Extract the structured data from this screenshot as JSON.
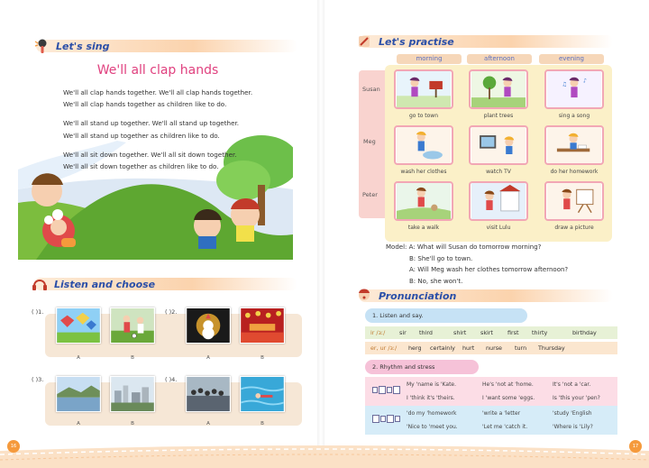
{
  "left_page": {
    "sing": {
      "section_title": "Let's sing",
      "song_title": "We'll all clap hands",
      "stanzas": [
        [
          "We'll all clap hands together.  We'll all clap hands together.",
          "We'll all clap hands together as children like to do."
        ],
        [
          "We'll all stand up together.  We'll all stand up together.",
          "We'll all stand up together as children like to do."
        ],
        [
          "We'll all sit down together.  We'll all sit down together.",
          "We'll all sit down together as children like to do."
        ]
      ]
    },
    "listen": {
      "section_title": "Listen and choose",
      "questions": [
        {
          "label": "(  )1.",
          "options": [
            "A",
            "B"
          ]
        },
        {
          "label": "(  )2.",
          "options": [
            "A",
            "B"
          ]
        },
        {
          "label": "(  )3.",
          "options": [
            "A",
            "B"
          ]
        },
        {
          "label": "(  )4.",
          "options": [
            "A",
            "B"
          ]
        }
      ]
    },
    "page_number": "16"
  },
  "right_page": {
    "practise": {
      "section_title": "Let's practise",
      "times": [
        "morning",
        "afternoon",
        "evening"
      ],
      "people": [
        "Susan",
        "Meg",
        "Peter"
      ],
      "activities": [
        [
          "go to town",
          "plant trees",
          "sing a song"
        ],
        [
          "wash her clothes",
          "watch TV",
          "do her homework"
        ],
        [
          "take a walk",
          "visit Lulu",
          "draw a picture"
        ]
      ],
      "model": [
        "Model:  A: What will Susan do tomorrow morning?",
        "B: She'll go to town.",
        "A: Will Meg wash her clothes tomorrow afternoon?",
        "B: No, she won't."
      ]
    },
    "pronunciation": {
      "section_title": "Pronunciation",
      "listen_say_label": "1. Listen and say.",
      "rows": [
        {
          "sound": "ir /ɜː/",
          "words": [
            "sir",
            "third",
            "shirt",
            "skirt",
            "first",
            "thirty",
            "birthday"
          ]
        },
        {
          "sound": "er, ur /ɜː/",
          "words": [
            "herg",
            "certainly",
            "hurt",
            "nurse",
            "turn",
            "Thursday"
          ]
        }
      ],
      "rhythm_label": "2. Rhythm and stress",
      "rhythm": [
        [
          [
            "My 'name is 'Kate.",
            "I 'think it's 'theirs."
          ],
          [
            "He's 'not at 'home.",
            "I 'want some 'eggs."
          ],
          [
            "It's 'not a 'car.",
            "Is 'this your 'pen?"
          ]
        ],
        [
          [
            "'do my 'homework",
            "'Nice to 'meet you."
          ],
          [
            "'write a 'letter",
            "'Let me 'catch it."
          ],
          [
            "'study 'English",
            "'Where is 'Lily?"
          ]
        ]
      ]
    },
    "page_number": "17"
  },
  "colors": {
    "title_blue": "#2b4fa8",
    "song_pink": "#e0417f",
    "cell_border": "#f2a7b5",
    "grid_yellow": "#fbf0c8",
    "rhythm_pink": "#fcdde6",
    "rhythm_blue": "#d6ecf8",
    "phonics_green": "#e7f1d6",
    "phonics_orange": "#fbe6cf",
    "footer_orange": "#f59a3c"
  }
}
